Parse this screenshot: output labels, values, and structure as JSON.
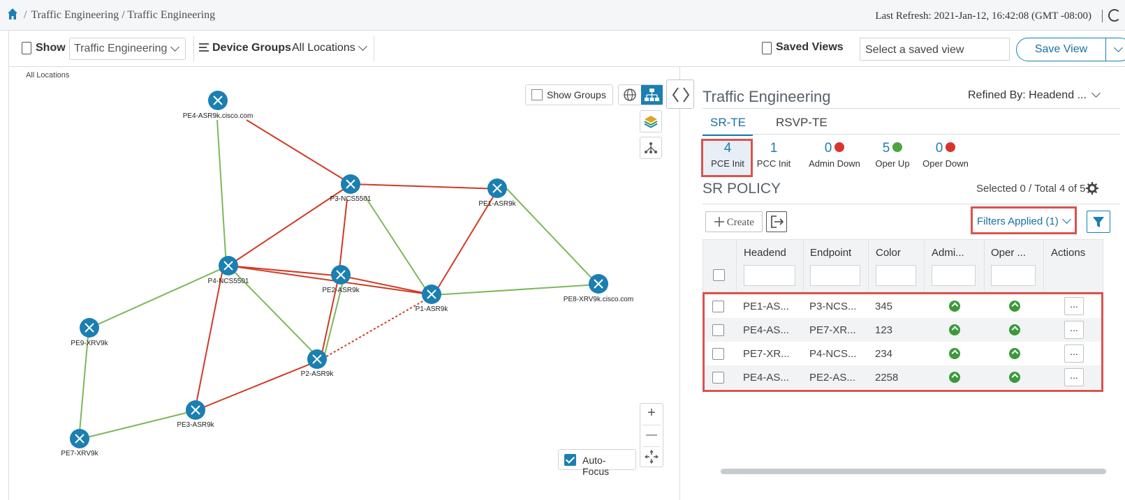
{
  "breadcrumb": {
    "separator": "/",
    "path": "Traffic Engineering / Traffic Engineering"
  },
  "last_refresh": "Last Refresh: 2021-Jan-12, 16:42:08 (GMT -08:00)",
  "toolbar": {
    "show_label": "Show",
    "show_value": "Traffic Engineering",
    "device_groups_label": "Device Groups",
    "device_groups_value": "All Locations",
    "saved_views_label": "Saved Views",
    "saved_views_placeholder": "Select a saved view",
    "save_view_label": "Save View"
  },
  "topology": {
    "scope": "All Locations",
    "show_groups_label": "Show Groups",
    "auto_focus_label": "Auto-Focus",
    "zoom_in": "+",
    "zoom_out": "—",
    "nodes": [
      "PE4-ASR9k.cisco.com",
      "P3-NCS5501",
      "PE1-ASR9k",
      "P4-NCS5501",
      "PE2-ASR9k",
      "P1-ASR9k",
      "PE8-XRV9k.cisco.com",
      "PE9-XRV9k",
      "P2-ASR9k",
      "PE3-ASR9k",
      "PE7-XRV9k"
    ],
    "link_colors": {
      "red": "#cf3b23",
      "green": "#7cb85a"
    },
    "node_color": "#1b7fb1"
  },
  "panel": {
    "title": "Traffic Engineering",
    "refined_by": "Refined By: Headend ...",
    "tabs": [
      "SR-TE",
      "RSVP-TE"
    ],
    "stats": [
      {
        "value": "4",
        "label": "PCE Init"
      },
      {
        "value": "1",
        "label": "PCC Init"
      },
      {
        "value": "0",
        "label": "Admin Down"
      },
      {
        "value": "5",
        "label": "Oper Up"
      },
      {
        "value": "0",
        "label": "Oper Down"
      }
    ],
    "sr_policy_title": "SR POLICY",
    "selected_total": "Selected 0 / Total 4 of 5",
    "create_label": "Create",
    "filters_label": "Filters Applied (1)",
    "columns": [
      "Headend",
      "Endpoint",
      "Color",
      "Admi...",
      "Oper ...",
      "Actions"
    ],
    "rows": [
      {
        "headend": "PE1-AS...",
        "endpoint": "P3-NCS...",
        "color": "345",
        "admin": "up",
        "oper": "up",
        "actions": "..."
      },
      {
        "headend": "PE4-AS...",
        "endpoint": "PE7-XR...",
        "color": "123",
        "admin": "up",
        "oper": "up",
        "actions": "..."
      },
      {
        "headend": "PE7-XR...",
        "endpoint": "P4-NCS...",
        "color": "234",
        "admin": "up",
        "oper": "up",
        "actions": "..."
      },
      {
        "headend": "PE4-AS...",
        "endpoint": "PE2-AS...",
        "color": "2258",
        "admin": "up",
        "oper": "up",
        "actions": "..."
      }
    ],
    "accent_color": "#1b7fb1",
    "highlight_color": "#d9534f"
  }
}
